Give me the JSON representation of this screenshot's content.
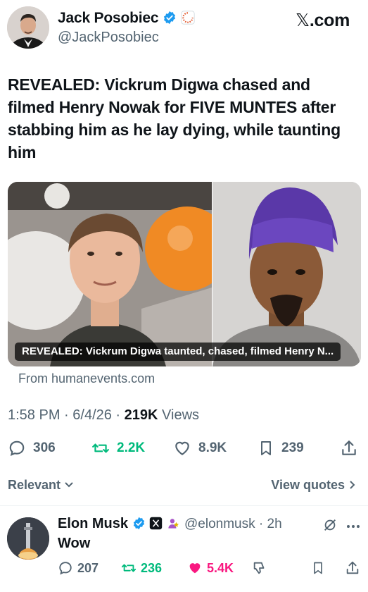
{
  "author": {
    "name": "Jack Posobiec",
    "handle": "@JackPosobiec"
  },
  "brand": {
    "symbol": "𝕏",
    "text": ".com"
  },
  "tweet": {
    "text": "REVEALED: Vickrum Digwa chased and filmed Henry Nowak for FIVE MUNTES after stabbing him as he lay dying, while taunting him"
  },
  "card": {
    "caption": "REVEALED: Vickrum Digwa taunted, chased, filmed Henry N...",
    "source": "From humanevents.com"
  },
  "meta": {
    "time": "1:58 PM",
    "sep": " · ",
    "date": "6/4/26",
    "views_count": "219K",
    "views_label": " Views"
  },
  "actions": {
    "replies": "306",
    "reposts": "2.2K",
    "likes": "8.9K",
    "bookmarks": "239"
  },
  "sort": {
    "label": "Relevant",
    "view_quotes": "View quotes"
  },
  "reply": {
    "name": "Elon Musk",
    "handle": "@elonmusk",
    "time": "2h",
    "text": "Wow",
    "replies": "207",
    "reposts": "236",
    "likes": "5.4K"
  },
  "colors": {
    "verified": "#1d9bf0",
    "repost": "#00ba7c",
    "like": "#f91880",
    "secondary": "#536471"
  }
}
